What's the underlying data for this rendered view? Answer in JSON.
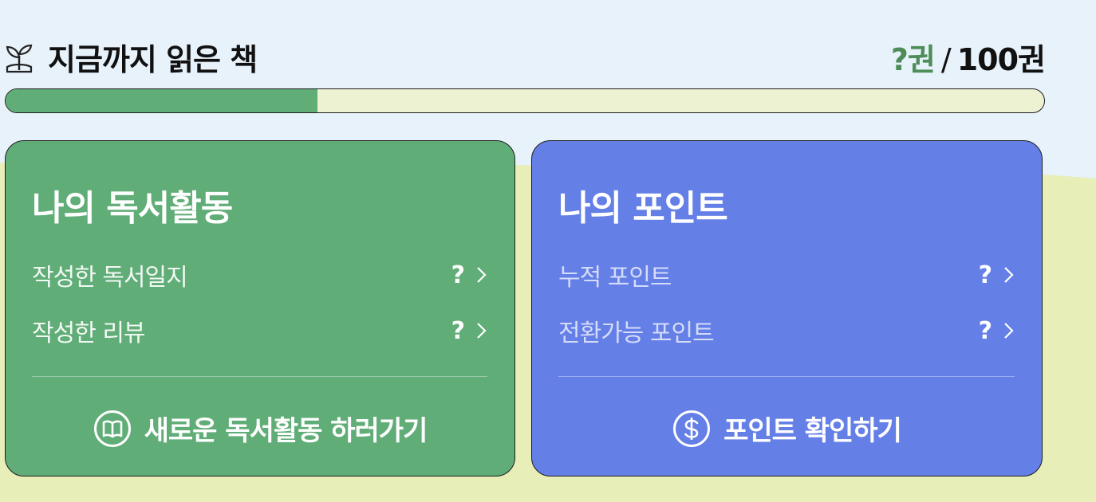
{
  "colors": {
    "sky": "#e8f2fb",
    "ground": "#e7eeb8",
    "accent_green": "#60ad77",
    "accent_blue": "#647fe6",
    "count_green": "#4e8d58"
  },
  "header": {
    "icon": "sprout-icon",
    "title": "지금까지 읽은 책",
    "read_count": "?권",
    "separator": "/",
    "goal": "100권"
  },
  "progress": {
    "fraction": 0.3
  },
  "reading_card": {
    "title": "나의 독서활동",
    "rows": [
      {
        "label": "작성한 독서일지",
        "value": "?",
        "icon": "chevron-right-icon"
      },
      {
        "label": "작성한 리뷰",
        "value": "?",
        "icon": "chevron-right-icon"
      }
    ],
    "action": {
      "icon": "book-circle-icon",
      "label": "새로운 독서활동 하러가기"
    }
  },
  "points_card": {
    "title": "나의 포인트",
    "rows": [
      {
        "label": "누적 포인트",
        "value": "?",
        "icon": "chevron-right-icon"
      },
      {
        "label": "전환가능 포인트",
        "value": "?",
        "icon": "chevron-right-icon"
      }
    ],
    "action": {
      "icon": "dollar-circle-icon",
      "label": "포인트 확인하기"
    }
  }
}
